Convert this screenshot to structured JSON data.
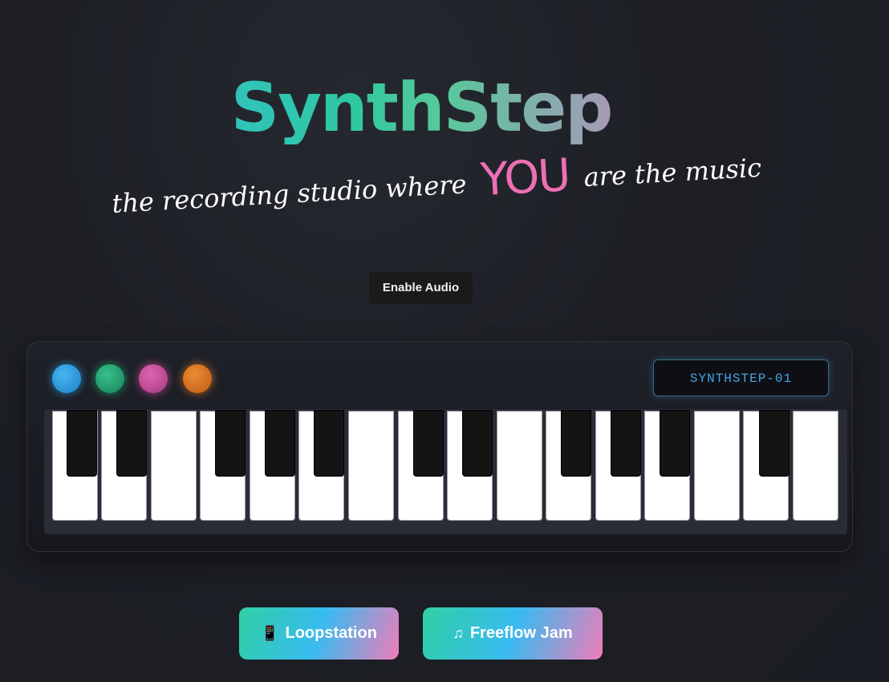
{
  "title": "SynthStep",
  "tagline": {
    "before": "the recording studio where",
    "emphasis": "YOU",
    "after": "are the music"
  },
  "enable_audio_label": "Enable Audio",
  "synth": {
    "display_text": "SYNTHSTEP-01",
    "knobs": [
      {
        "name": "blue-knob",
        "color": "#2f9ee0"
      },
      {
        "name": "green-knob",
        "color": "#2aa878"
      },
      {
        "name": "pink-knob",
        "color": "#c9509a"
      },
      {
        "name": "orange-knob",
        "color": "#dc7a28"
      }
    ],
    "white_key_count": 16,
    "black_key_count": 11
  },
  "modes": [
    {
      "label": "Loopstation",
      "icon": "phone-icon"
    },
    {
      "label": "Freeflow Jam",
      "icon": "music-notes-icon"
    }
  ],
  "colors": {
    "accent_gradient_start": "#2fd0a4",
    "accent_gradient_mid": "#38bbf0",
    "accent_gradient_end": "#f07cb9",
    "emphasis_pink": "#ee6fb4",
    "display_text": "#45a4de"
  }
}
